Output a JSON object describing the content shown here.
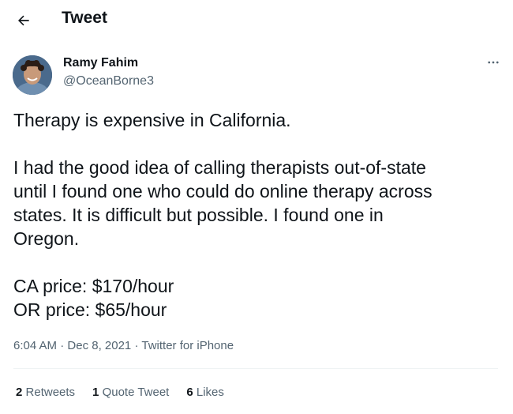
{
  "header": {
    "back_icon": "arrow-left-icon",
    "title": "Tweet"
  },
  "author": {
    "name": "Ramy Fahim",
    "handle": "@OceanBorne3",
    "more_icon": "more-horizontal-icon"
  },
  "tweet": {
    "paragraph1": "Therapy is expensive in California.",
    "paragraph2_lines": [
      "I had the good idea of calling therapists out-of-state",
      "until I found one who could do online therapy across",
      "states. It is difficult but possible. I found one in",
      "Oregon."
    ],
    "price_ca": "CA price: $170/hour",
    "price_or": "OR price: $65/hour"
  },
  "meta": {
    "time": "6:04 AM",
    "separator": "·",
    "date": "Dec 8, 2021",
    "source": "Twitter for iPhone"
  },
  "stats": {
    "retweets_count": "2",
    "retweets_label": "Retweets",
    "quotes_count": "1",
    "quotes_label": "Quote Tweet",
    "likes_count": "6",
    "likes_label": "Likes"
  },
  "colors": {
    "text_primary": "#0f1419",
    "text_secondary": "#536471",
    "divider": "#eff3f4"
  }
}
